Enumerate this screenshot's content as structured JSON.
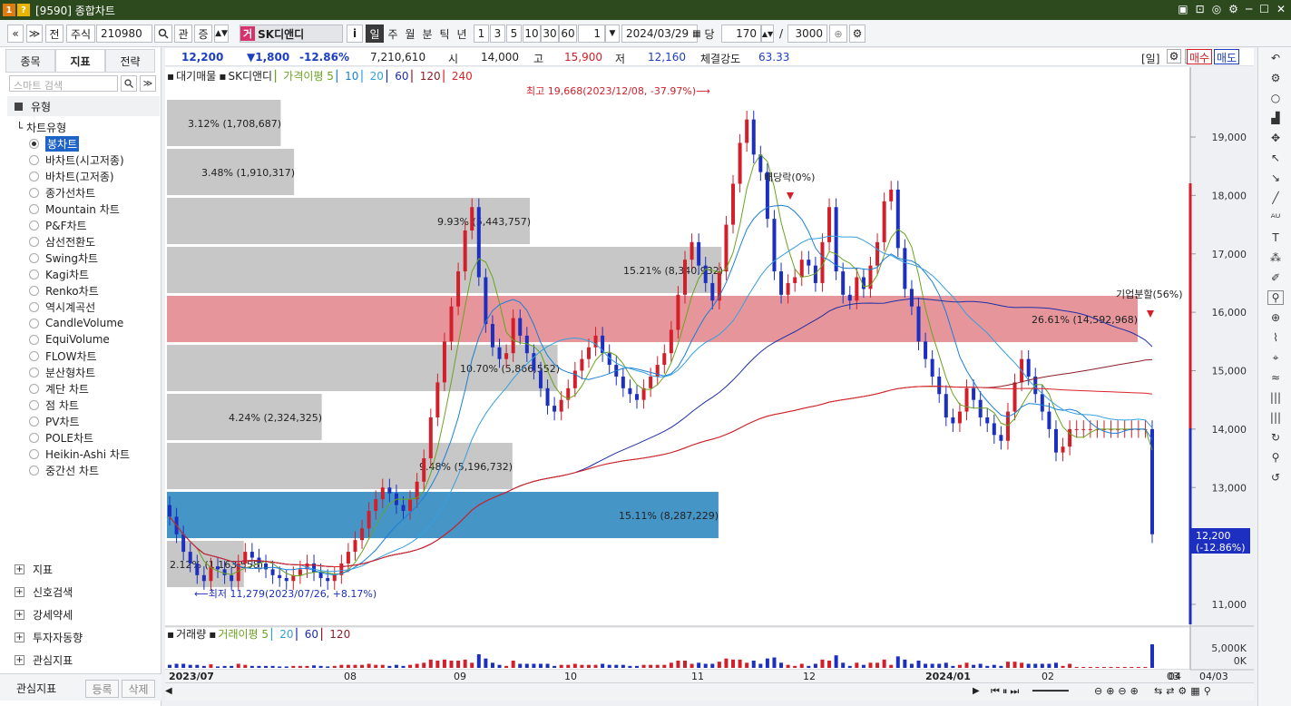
{
  "window": {
    "badge1": "1",
    "badge2": "?",
    "title": "[9590] 종합차트",
    "controls": [
      "▣",
      "⊡",
      "◎",
      "⚙",
      "─",
      "☐",
      "✕"
    ]
  },
  "toolbar": {
    "nav_prev": "«",
    "nav_menu": "≫",
    "mode_all": "전",
    "market": "주식",
    "code": "210980",
    "search_icon": "search-icon",
    "rel": "관",
    "updown": "증",
    "stock_badge": "거",
    "stock_name": "SK디앤디",
    "info": "i",
    "periods": [
      "일",
      "주",
      "월",
      "분",
      "틱",
      "년"
    ],
    "minutes": [
      "1",
      "3",
      "5",
      "10",
      "30",
      "60"
    ],
    "interval_value": "1",
    "date": "2024/03/29",
    "date_label": "당",
    "count": "170",
    "total": "3000",
    "slash": "/"
  },
  "left": {
    "tabs": [
      "종목",
      "지표",
      "전략"
    ],
    "search_placeholder": "스마트 검색",
    "category": "유형",
    "tree_root": "차트유형",
    "chart_types": [
      "봉차트",
      "바차트(시고저종)",
      "바차트(고저종)",
      "종가선차트",
      "Mountain 차트",
      "P&F차트",
      "삼선전환도",
      "Swing차트",
      "Kagi차트",
      "Renko차트",
      "역시계곡선",
      "CandleVolume",
      "EquiVolume",
      "FLOW차트",
      "분산형차트",
      "계단 차트",
      "점 차트",
      "PV차트",
      "POLE차트",
      "Heikin-Ashi 차트",
      "중간선 차트"
    ],
    "groups": [
      "지표",
      "신호검색",
      "강세약세",
      "투자자동향",
      "관심지표"
    ],
    "watch_label": "관심지표",
    "register": "등록",
    "delete": "삭제"
  },
  "info": {
    "price": "12,200",
    "change": "▼1,800",
    "change_pct": "-12.86%",
    "volume": "7,210,610",
    "open_label": "시",
    "open": "14,000",
    "high_label": "고",
    "high": "15,900",
    "low_label": "저",
    "low": "12,160",
    "strength_label": "체결강도",
    "strength": "63.33",
    "period_tag": "[일]",
    "buy": "매수",
    "sell": "매도"
  },
  "legend": {
    "items": [
      "대기매물",
      "SK디앤디",
      "가격이평 5",
      "10",
      "20",
      "60",
      "120",
      "240"
    ],
    "colors": [
      "#222222",
      "#222222",
      "#6aa321",
      "#1a7fd8",
      "#35a0e0",
      "#1f2fa6",
      "#8a1f2a",
      "#d9242a"
    ]
  },
  "vol_legend": {
    "items": [
      "거래량",
      "거래이평 5",
      "20",
      "60",
      "120"
    ],
    "colors": [
      "#222222",
      "#6aa321",
      "#35a0e0",
      "#1f2fa6",
      "#8a1f2a"
    ]
  },
  "chart": {
    "price_axis": [
      "19,000",
      "18,000",
      "17,000",
      "16,000",
      "15,000",
      "14,000",
      "13,000",
      "12,000",
      "11,000"
    ],
    "current_price_tag": "12,200",
    "current_pct_tag": "(-12.86%)",
    "vol_axis": [
      "5,000K",
      "0K"
    ],
    "x_labels": [
      "2023/07",
      "08",
      "09",
      "10",
      "11",
      "12",
      "2024/01",
      "02",
      "03",
      "04"
    ],
    "date_tag": "04/03",
    "high_note": "최고 19,668(2023/12/08, -37.97%)⟶",
    "low_note": "⟵최저 11,279(2023/07/26, +8.17%)",
    "dividend_note": "배당락(0%)",
    "split_note": "기업분할(56%)",
    "volume_profile": [
      {
        "label": "3.12% (1,708,687)",
        "highlight": "none"
      },
      {
        "label": "3.48% (1,910,317)",
        "highlight": "none"
      },
      {
        "label": "9.93% (5,443,757)",
        "highlight": "none"
      },
      {
        "label": "15.21% (8,340,932)",
        "highlight": "none"
      },
      {
        "label": "26.61% (14,592,968)",
        "highlight": "max"
      },
      {
        "label": "10.70% (5,866,552)",
        "highlight": "none"
      },
      {
        "label": "4.24% (2,324,325)",
        "highlight": "none"
      },
      {
        "label": "9.48% (5,196,732)",
        "highlight": "none"
      },
      {
        "label": "15.11% (8,287,229)",
        "highlight": "current"
      },
      {
        "label": "2.12% (1,163,558)",
        "highlight": "none"
      }
    ],
    "profile_colors": {
      "none": "#c4c4c4",
      "max": "#e58f95",
      "current": "#3b8fc4"
    }
  }
}
